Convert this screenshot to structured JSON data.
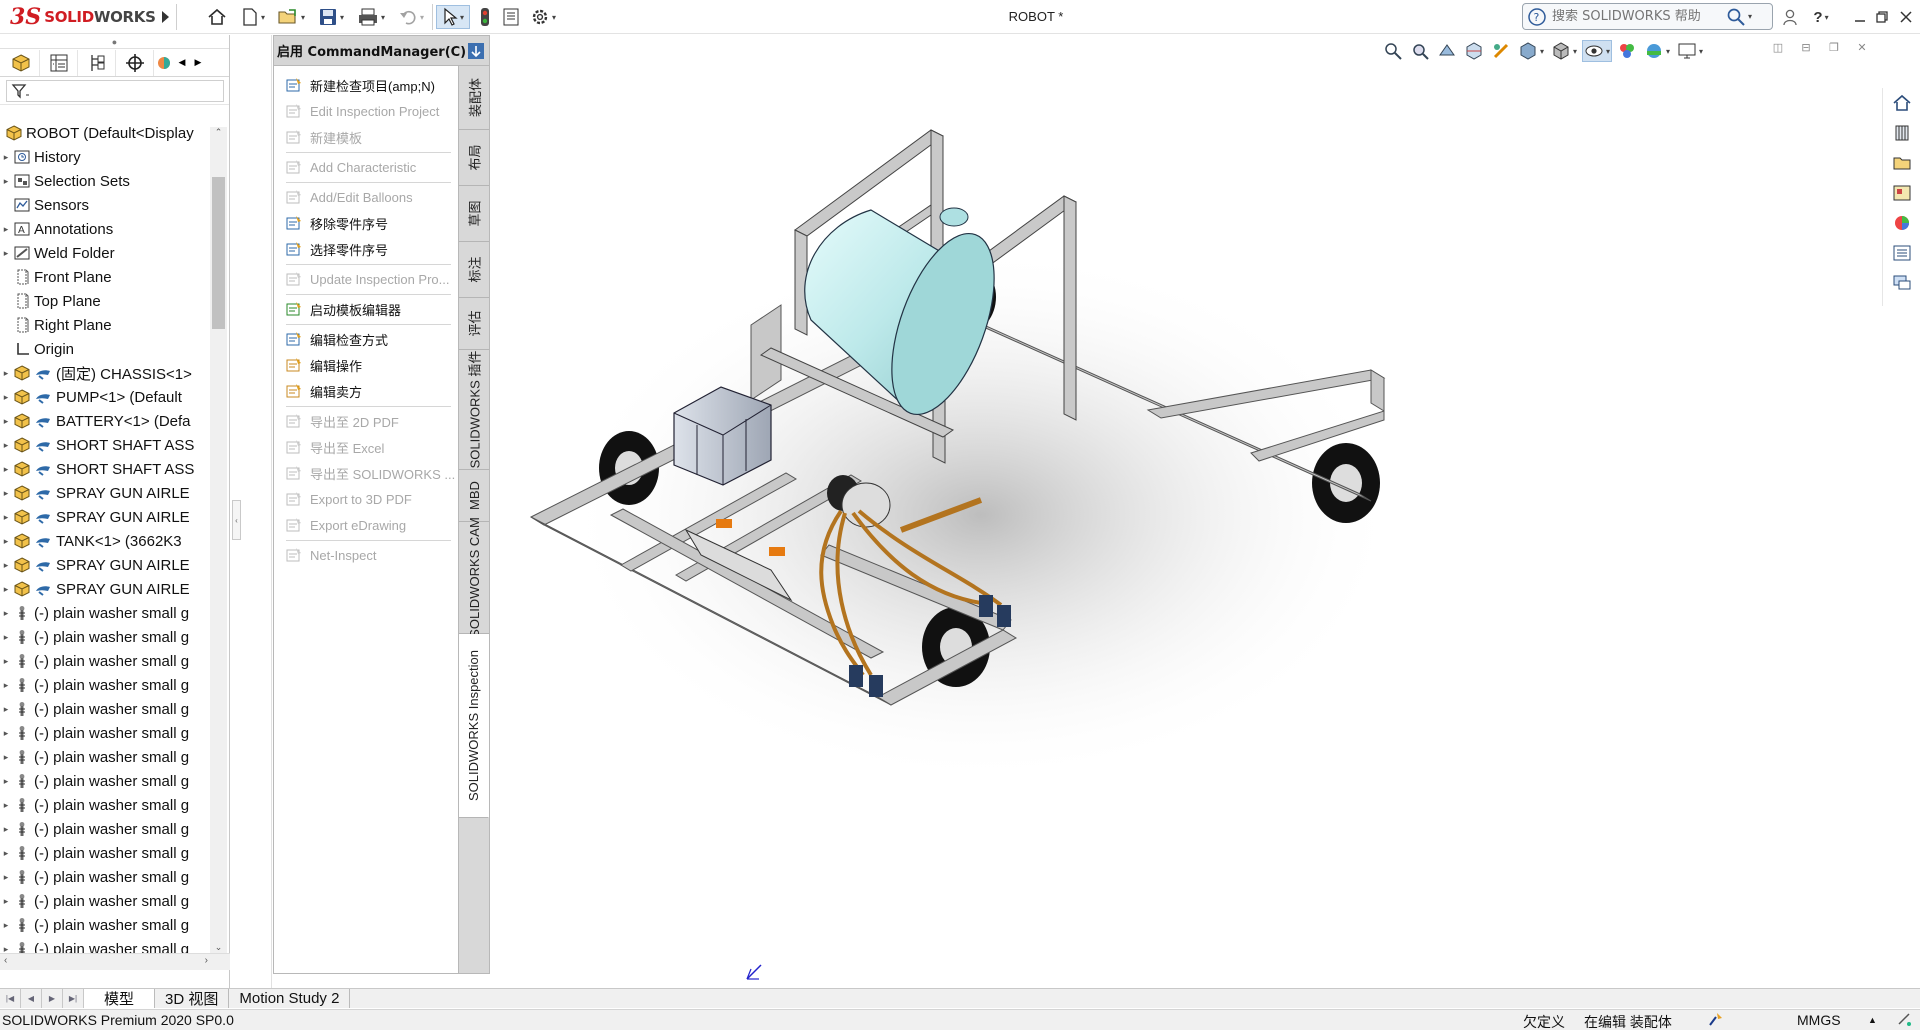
{
  "app": {
    "logo_ds": "3S",
    "logo_solid": "SOLID",
    "logo_works": "WORKS",
    "document_title": "ROBOT *",
    "search_placeholder": "搜索 SOLIDWORKS 帮助"
  },
  "feature_tree": {
    "root": "ROBOT  (Default<Display",
    "items": [
      {
        "label": "History",
        "kind": "history",
        "expand": true
      },
      {
        "label": "Selection Sets",
        "kind": "selection",
        "expand": true
      },
      {
        "label": "Sensors",
        "kind": "sensors",
        "expand": false
      },
      {
        "label": "Annotations",
        "kind": "annotations",
        "expand": true
      },
      {
        "label": "Weld Folder",
        "kind": "weld",
        "expand": true
      },
      {
        "label": "Front Plane",
        "kind": "plane",
        "expand": false
      },
      {
        "label": "Top Plane",
        "kind": "plane",
        "expand": false
      },
      {
        "label": "Right Plane",
        "kind": "plane",
        "expand": false
      },
      {
        "label": "Origin",
        "kind": "origin",
        "expand": false
      },
      {
        "label": "(固定) CHASSIS<1>",
        "kind": "asm",
        "expand": true
      },
      {
        "label": "PUMP<1> (Default",
        "kind": "asm",
        "expand": true
      },
      {
        "label": "BATTERY<1> (Defa",
        "kind": "asm",
        "expand": true
      },
      {
        "label": "SHORT SHAFT ASS",
        "kind": "asm",
        "expand": true
      },
      {
        "label": "SHORT SHAFT ASS",
        "kind": "asm",
        "expand": true
      },
      {
        "label": "SPRAY GUN AIRLE",
        "kind": "asm",
        "expand": true
      },
      {
        "label": "SPRAY GUN AIRLE",
        "kind": "asm",
        "expand": true
      },
      {
        "label": "TANK<1> (3662K3",
        "kind": "asm",
        "expand": true
      },
      {
        "label": "SPRAY GUN AIRLE",
        "kind": "asm",
        "expand": true
      },
      {
        "label": "SPRAY GUN AIRLE",
        "kind": "asm",
        "expand": true
      },
      {
        "label": "(-) plain washer small g",
        "kind": "part",
        "expand": true
      },
      {
        "label": "(-) plain washer small g",
        "kind": "part",
        "expand": true
      },
      {
        "label": "(-) plain washer small g",
        "kind": "part",
        "expand": true
      },
      {
        "label": "(-) plain washer small g",
        "kind": "part",
        "expand": true
      },
      {
        "label": "(-) plain washer small g",
        "kind": "part",
        "expand": true
      },
      {
        "label": "(-) plain washer small g",
        "kind": "part",
        "expand": true
      },
      {
        "label": "(-) plain washer small g",
        "kind": "part",
        "expand": true
      },
      {
        "label": "(-) plain washer small g",
        "kind": "part",
        "expand": true
      },
      {
        "label": "(-) plain washer small g",
        "kind": "part",
        "expand": true
      },
      {
        "label": "(-) plain washer small g",
        "kind": "part",
        "expand": true
      },
      {
        "label": "(-) plain washer small g",
        "kind": "part",
        "expand": true
      },
      {
        "label": "(-) plain washer small g",
        "kind": "part",
        "expand": true
      },
      {
        "label": "(-) plain washer small g",
        "kind": "part",
        "expand": true
      },
      {
        "label": "(-) plain washer small g",
        "kind": "part",
        "expand": true
      },
      {
        "label": "(-) plain washer small g",
        "kind": "part",
        "expand": true
      }
    ]
  },
  "command_manager": {
    "title": "启用 CommandManager(C)",
    "items": [
      {
        "label": "新建检查项目(amp;N)",
        "enabled": true,
        "icon": "new-inspection-project-icon"
      },
      {
        "label": "Edit Inspection Project",
        "enabled": false,
        "icon": "edit-inspection-project-icon"
      },
      {
        "label": "新建模板",
        "enabled": false,
        "icon": "new-template-icon"
      },
      {
        "sep": true
      },
      {
        "label": "Add Characteristic",
        "enabled": false,
        "icon": "add-characteristic-icon"
      },
      {
        "sep": true
      },
      {
        "label": "Add/Edit Balloons",
        "enabled": false,
        "icon": "balloons-icon"
      },
      {
        "label": "移除零件序号",
        "enabled": true,
        "icon": "remove-balloon-icon"
      },
      {
        "label": "选择零件序号",
        "enabled": true,
        "icon": "select-balloon-icon"
      },
      {
        "sep": true
      },
      {
        "label": "Update Inspection Pro...",
        "enabled": false,
        "icon": "update-inspection-icon"
      },
      {
        "sep": true
      },
      {
        "label": "启动模板编辑器",
        "enabled": true,
        "icon": "template-editor-icon"
      },
      {
        "sep": true
      },
      {
        "label": "编辑检查方式",
        "enabled": true,
        "icon": "edit-method-icon"
      },
      {
        "label": "编辑操作",
        "enabled": true,
        "icon": "edit-operation-icon"
      },
      {
        "label": "编辑卖方",
        "enabled": true,
        "icon": "edit-vendor-icon"
      },
      {
        "sep": true
      },
      {
        "label": "导出至 2D PDF",
        "enabled": false,
        "icon": "export-2d-pdf-icon"
      },
      {
        "label": "导出至 Excel",
        "enabled": false,
        "icon": "export-excel-icon"
      },
      {
        "label": "导出至 SOLIDWORKS ...",
        "enabled": false,
        "icon": "export-solidworks-icon"
      },
      {
        "label": "Export to 3D PDF",
        "enabled": false,
        "icon": "export-3d-pdf-icon"
      },
      {
        "label": "Export eDrawing",
        "enabled": false,
        "icon": "export-edrawing-icon"
      },
      {
        "sep": true
      },
      {
        "label": "Net-Inspect",
        "enabled": false,
        "icon": "net-inspect-icon"
      }
    ],
    "vertical_tabs": [
      "装配体",
      "布局",
      "草图",
      "标注",
      "评估",
      "SOLIDWORKS 插件",
      "MBD",
      "SOLIDWORKS CAM",
      "SOLIDWORKS Inspection"
    ]
  },
  "bottom_tabs": [
    "模型",
    "3D 视图",
    "Motion Study 2"
  ],
  "status": {
    "product": "SOLIDWORKS Premium 2020 SP0.0",
    "definition": "欠定义",
    "editing": "在编辑 装配体",
    "units": "MMGS",
    "units_caret": "▲"
  },
  "colors": {
    "brand_red": "#d01c22",
    "panel_bg": "#d6d6d6",
    "tank": "#bde9ea",
    "frame": "#c8c8c8",
    "hose": "#b3741f"
  }
}
